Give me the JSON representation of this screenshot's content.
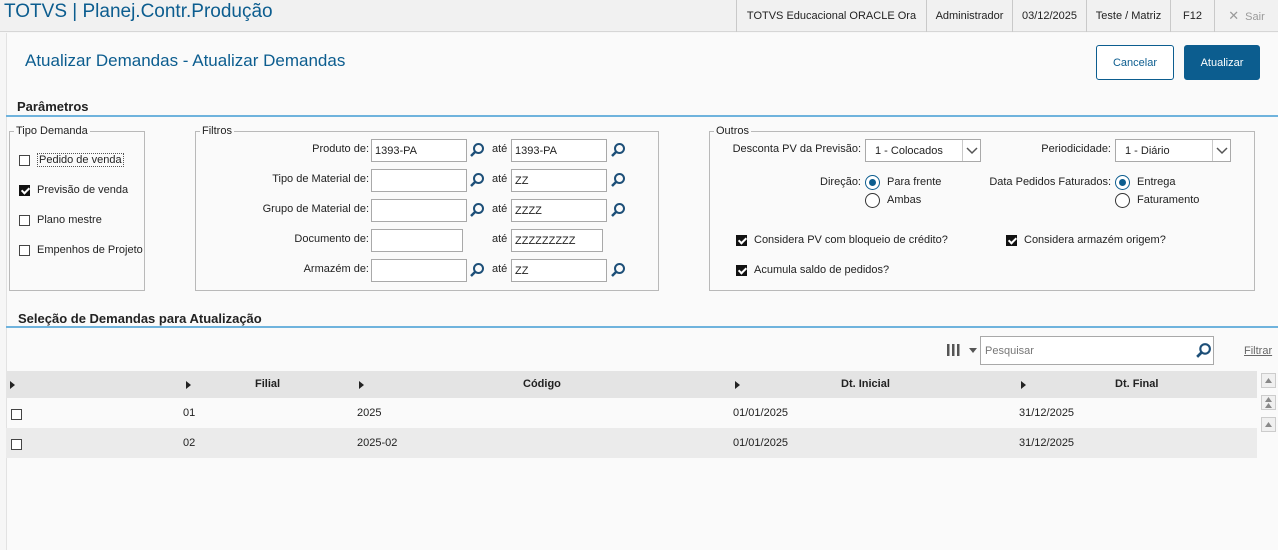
{
  "topbar": {
    "app_title": "TOTVS | Planej.Contr.Produção",
    "environment": "TOTVS Educacional ORACLE Ora",
    "user": "Administrador",
    "date": "03/12/2025",
    "company": "Teste / Matriz",
    "key_hint": "F12",
    "exit_label": "Sair",
    "exit_icon": "✕"
  },
  "page": {
    "title": "Atualizar Demandas - Atualizar Demandas",
    "cancel_label": "Cancelar",
    "update_label": "Atualizar"
  },
  "params": {
    "section_title": "Parâmetros",
    "tipo_demanda": {
      "legend": "Tipo Demanda",
      "options": [
        {
          "label": "Pedido de venda",
          "checked": false
        },
        {
          "label": "Previsão de venda",
          "checked": true
        },
        {
          "label": "Plano mestre",
          "checked": false
        },
        {
          "label": "Empenhos de Projeto",
          "checked": false
        }
      ]
    },
    "filtros": {
      "legend": "Filtros",
      "to_label": "até",
      "rows": [
        {
          "label": "Produto de:",
          "from": "1393-PA",
          "to": "1393-PA"
        },
        {
          "label": "Tipo de Material de:",
          "from": "",
          "to": "ZZ"
        },
        {
          "label": "Grupo de Material de:",
          "from": "",
          "to": "ZZZZ"
        },
        {
          "label": "Documento de:",
          "from": "",
          "to": "ZZZZZZZZZ"
        },
        {
          "label": "Armazém de:",
          "from": "",
          "to": "ZZ"
        }
      ]
    },
    "outros": {
      "legend": "Outros",
      "desconta_label": "Desconta PV da Previsão:",
      "desconta_value": "1 - Colocados",
      "periodicidade_label": "Periodicidade:",
      "periodicidade_value": "1 - Diário",
      "direcao_label": "Direção:",
      "direcao_options": [
        {
          "label": "Para frente",
          "selected": true
        },
        {
          "label": "Ambas",
          "selected": false
        }
      ],
      "data_pedidos_label": "Data Pedidos Faturados:",
      "data_pedidos_options": [
        {
          "label": "Entrega",
          "selected": true
        },
        {
          "label": "Faturamento",
          "selected": false
        }
      ],
      "checks": [
        {
          "label": "Considera PV com bloqueio de crédito?",
          "checked": true
        },
        {
          "label": "Considera armazém origem?",
          "checked": true
        },
        {
          "label": "Acumula saldo de pedidos?",
          "checked": true
        }
      ]
    }
  },
  "selection": {
    "section_title": "Seleção de Demandas para Atualização",
    "search_placeholder": "Pesquisar",
    "filter_link": "Filtrar",
    "columns": [
      "Filial",
      "Código",
      "Dt. Inicial",
      "Dt. Final"
    ],
    "rows": [
      {
        "checked": false,
        "filial": "01",
        "codigo": "2025",
        "dt_inicial": "01/01/2025",
        "dt_final": "31/12/2025"
      },
      {
        "checked": false,
        "filial": "02",
        "codigo": "2025-02",
        "dt_inicial": "01/01/2025",
        "dt_final": "31/12/2025"
      }
    ]
  },
  "colors": {
    "brand": "#0c5d8f",
    "accent_line": "#6fb3dd"
  },
  "icons": [
    "search-icon",
    "close-icon",
    "columns-icon",
    "chevron-down-icon",
    "sort-arrow-icon",
    "scroll-up-icon",
    "scroll-down-icon"
  ]
}
